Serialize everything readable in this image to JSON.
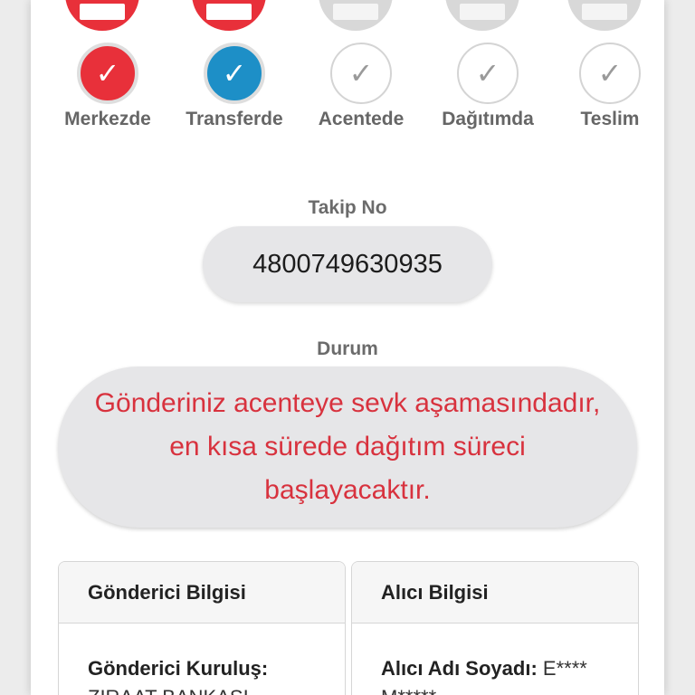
{
  "steps": [
    {
      "label": "Merkezde",
      "status": "done",
      "color": "#e8303a"
    },
    {
      "label": "Transferde",
      "status": "done",
      "color": "#1d8fc7"
    },
    {
      "label": "Acentede",
      "status": "pending"
    },
    {
      "label": "Dağıtımda",
      "status": "pending"
    },
    {
      "label": "Teslim",
      "status": "pending"
    }
  ],
  "check_glyph": "✓",
  "tracking": {
    "label": "Takip No",
    "value": "4800749630935"
  },
  "status": {
    "label": "Durum",
    "text": "Gönderiniz acenteye sevk aşamasındadır, en kısa sürede dağıtım süreci başlayacaktır."
  },
  "sender": {
    "title": "Gönderici Bilgisi",
    "field_label": "Gönderici Kuruluş:",
    "field_value": "ZIRAAT BANKASI"
  },
  "receiver": {
    "title": "Alıcı Bilgisi",
    "field_label": "Alıcı Adı Soyadı:",
    "field_value": "E**** M*****"
  }
}
